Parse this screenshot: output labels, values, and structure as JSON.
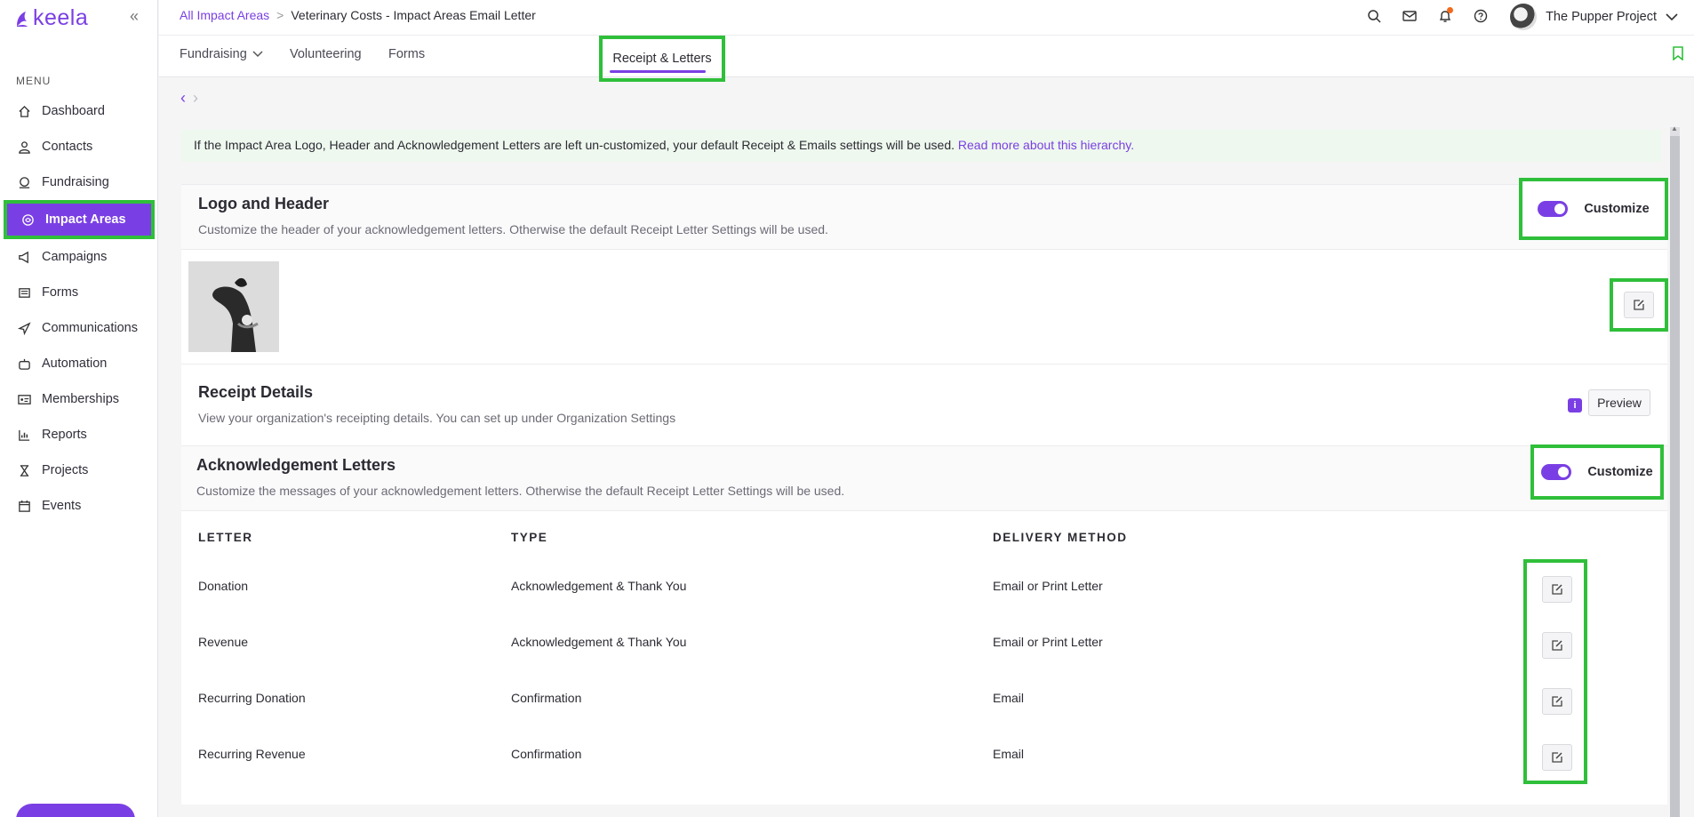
{
  "brand": {
    "name": "keela",
    "accent": "#7a3fe4",
    "highlight": "#2fbf3a"
  },
  "sidebar": {
    "menu_label": "MENU",
    "items": [
      {
        "label": "Dashboard",
        "icon": "home-icon"
      },
      {
        "label": "Contacts",
        "icon": "person-icon"
      },
      {
        "label": "Fundraising",
        "icon": "coin-icon"
      },
      {
        "label": "Impact Areas",
        "icon": "hand-heart-icon",
        "active": true
      },
      {
        "label": "Campaigns",
        "icon": "megaphone-icon"
      },
      {
        "label": "Forms",
        "icon": "form-icon"
      },
      {
        "label": "Communications",
        "icon": "paper-plane-icon"
      },
      {
        "label": "Automation",
        "icon": "robot-icon"
      },
      {
        "label": "Memberships",
        "icon": "id-card-icon"
      },
      {
        "label": "Reports",
        "icon": "bar-chart-icon"
      },
      {
        "label": "Projects",
        "icon": "hourglass-icon"
      },
      {
        "label": "Events",
        "icon": "calendar-icon"
      }
    ]
  },
  "header": {
    "breadcrumb_parent": "All Impact Areas",
    "breadcrumb_separator": ">",
    "breadcrumb_current": "Veterinary Costs - Impact Areas Email Letter",
    "org_name": "The Pupper Project"
  },
  "tabs": {
    "fundraising": "Fundraising",
    "volunteering": "Volunteering",
    "forms": "Forms",
    "receipts": "Receipt & Letters"
  },
  "banner": {
    "text": "If the Impact Area Logo, Header and Acknowledgement Letters are left un-customized, your default Receipt & Emails settings will be used. ",
    "link": "Read more about this hierarchy."
  },
  "logo_header": {
    "title": "Logo and Header",
    "description": "Customize the header of your acknowledgement letters. Otherwise the default Receipt Letter Settings will be used.",
    "customize_label": "Customize",
    "customized": true
  },
  "receipt_details": {
    "title": "Receipt Details",
    "description": "View your organization's receipting details. You can set up under Organization Settings",
    "preview_label": "Preview",
    "info_badge": "i"
  },
  "ack_letters": {
    "title": "Acknowledgement Letters",
    "description": "Customize the messages of your acknowledgement letters. Otherwise the default Receipt Letter Settings will be used.",
    "customize_label": "Customize",
    "customized": true,
    "columns": [
      "LETTER",
      "TYPE",
      "DELIVERY METHOD"
    ],
    "rows": [
      {
        "letter": "Donation",
        "type": "Acknowledgement & Thank You",
        "delivery": "Email or Print Letter"
      },
      {
        "letter": "Revenue",
        "type": "Acknowledgement & Thank You",
        "delivery": "Email or Print Letter"
      },
      {
        "letter": "Recurring Donation",
        "type": "Confirmation",
        "delivery": "Email"
      },
      {
        "letter": "Recurring Revenue",
        "type": "Confirmation",
        "delivery": "Email"
      }
    ]
  }
}
